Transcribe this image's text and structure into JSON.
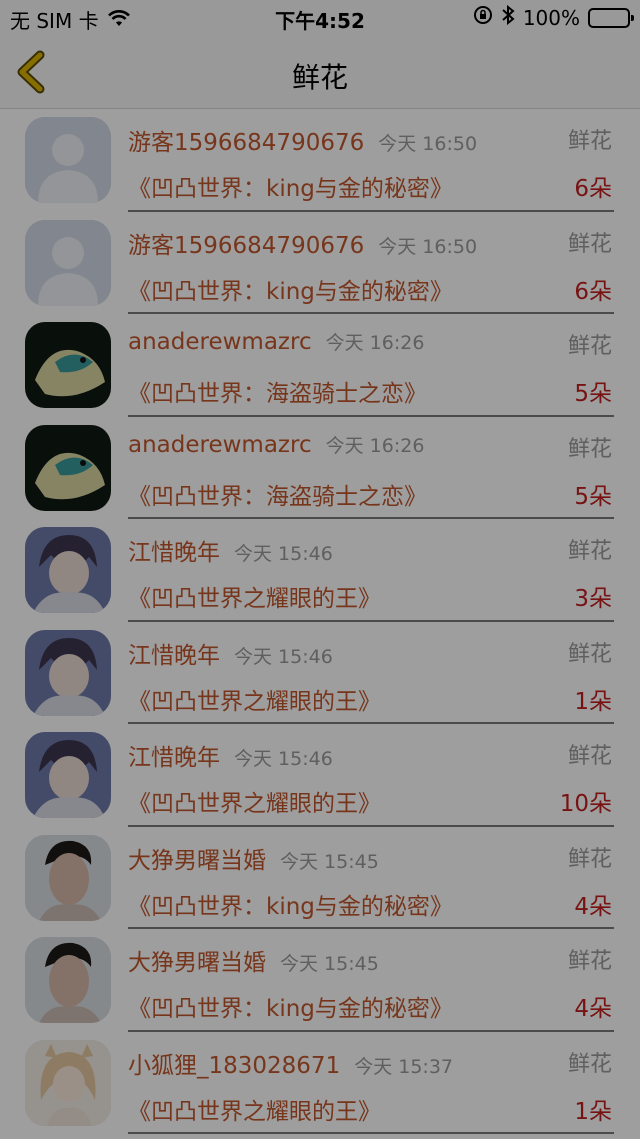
{
  "status_bar": {
    "carrier": "无 SIM 卡",
    "time": "下午4:52",
    "battery": "100%"
  },
  "nav": {
    "title": "鲜花"
  },
  "rows": [
    {
      "user": "游客1596684790676",
      "time": "今天 16:50",
      "type": "鲜花",
      "book": "《凹凸世界：king与金的秘密》",
      "count": "6朵",
      "avatar": "default-avatar-icon"
    },
    {
      "user": "游客1596684790676",
      "time": "今天 16:50",
      "type": "鲜花",
      "book": "《凹凸世界：king与金的秘密》",
      "count": "6朵",
      "avatar": "default-avatar-icon"
    },
    {
      "user": "anaderewmazrc",
      "time": "今天 16:26",
      "type": "鲜花",
      "book": "《凹凸世界：海盗骑士之恋》",
      "count": "5朵",
      "avatar": "fish-avatar"
    },
    {
      "user": "anaderewmazrc",
      "time": "今天 16:26",
      "type": "鲜花",
      "book": "《凹凸世界：海盗骑士之恋》",
      "count": "5朵",
      "avatar": "fish-avatar"
    },
    {
      "user": "江惜晚年",
      "time": "今天 15:46",
      "type": "鲜花",
      "book": "《凹凸世界之耀眼的王》",
      "count": "3朵",
      "avatar": "anime-boy-avatar"
    },
    {
      "user": "江惜晚年",
      "time": "今天 15:46",
      "type": "鲜花",
      "book": "《凹凸世界之耀眼的王》",
      "count": "1朵",
      "avatar": "anime-boy-avatar"
    },
    {
      "user": "江惜晚年",
      "time": "今天 15:46",
      "type": "鲜花",
      "book": "《凹凸世界之耀眼的王》",
      "count": "10朵",
      "avatar": "anime-boy-avatar"
    },
    {
      "user": "大狰男曙当婚",
      "time": "今天 15:45",
      "type": "鲜花",
      "book": "《凹凸世界：king与金的秘密》",
      "count": "4朵",
      "avatar": "man-portrait-avatar"
    },
    {
      "user": "大狰男曙当婚",
      "time": "今天 15:45",
      "type": "鲜花",
      "book": "《凹凸世界：king与金的秘密》",
      "count": "4朵",
      "avatar": "man-portrait-avatar"
    },
    {
      "user": "小狐狸_183028671",
      "time": "今天 15:37",
      "type": "鲜花",
      "book": "《凹凸世界之耀眼的王》",
      "count": "1朵",
      "avatar": "anime-girl-avatar"
    }
  ],
  "colors": {
    "accent_back": "#c9a800",
    "username": "#c0582e",
    "count": "#c21f1f"
  }
}
